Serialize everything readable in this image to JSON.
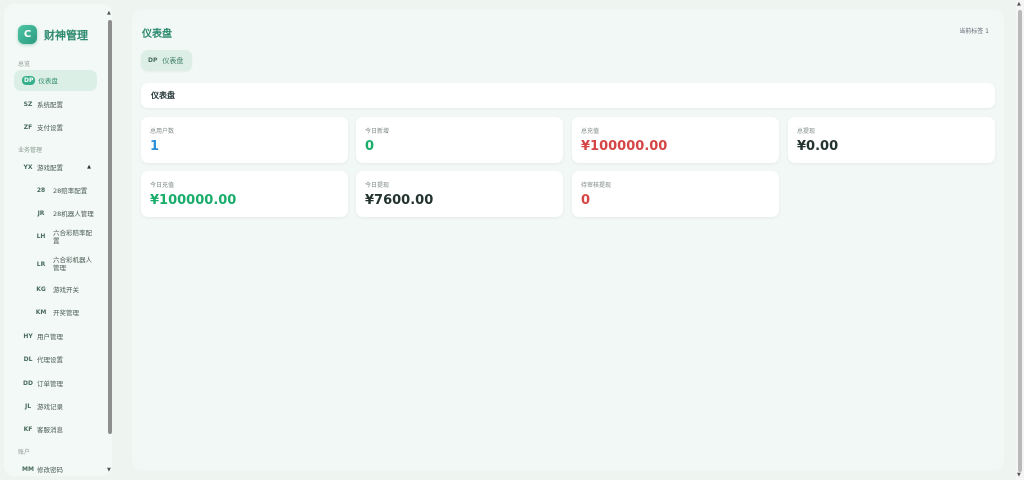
{
  "brand": {
    "logo_letter": "C",
    "name": "财神管理"
  },
  "sidebar": {
    "sections": {
      "overview": "总览",
      "business": "业务管理",
      "account": "账户"
    },
    "items": [
      {
        "code": "DP",
        "label": "仪表盘"
      },
      {
        "code": "SZ",
        "label": "系统配置"
      },
      {
        "code": "ZF",
        "label": "支付设置"
      },
      {
        "code": "YX",
        "label": "游戏配置"
      },
      {
        "code": "28",
        "label": "28赔率配置"
      },
      {
        "code": "JR",
        "label": "28机器人管理"
      },
      {
        "code": "LH",
        "label": "六合彩赔率配置"
      },
      {
        "code": "LR",
        "label": "六合彩机器人管理"
      },
      {
        "code": "KG",
        "label": "游戏开关"
      },
      {
        "code": "KM",
        "label": "开奖管理"
      },
      {
        "code": "HY",
        "label": "用户管理"
      },
      {
        "code": "DL",
        "label": "代理设置"
      },
      {
        "code": "DD",
        "label": "订单管理"
      },
      {
        "code": "JL",
        "label": "游戏记录"
      },
      {
        "code": "KF",
        "label": "客服消息"
      },
      {
        "code": "MM",
        "label": "修改密码"
      }
    ]
  },
  "main": {
    "title": "仪表盘",
    "current_tag": "当前标签 1",
    "tab": {
      "code": "DP",
      "label": "仪表盘"
    },
    "panel_title": "仪表盘",
    "stats": [
      {
        "label": "总用户数",
        "value": "1",
        "color": "#2f8fd8"
      },
      {
        "label": "今日新增",
        "value": "0",
        "color": "#19ad6c"
      },
      {
        "label": "总充值",
        "value": "¥100000.00",
        "color": "#d64545"
      },
      {
        "label": "总提现",
        "value": "¥0.00",
        "color": "#233330"
      },
      {
        "label": "今日充值",
        "value": "¥100000.00",
        "color": "#19ad6c"
      },
      {
        "label": "今日提现",
        "value": "¥7600.00",
        "color": "#233330"
      },
      {
        "label": "待审核提现",
        "value": "0",
        "color": "#d64545"
      }
    ]
  }
}
